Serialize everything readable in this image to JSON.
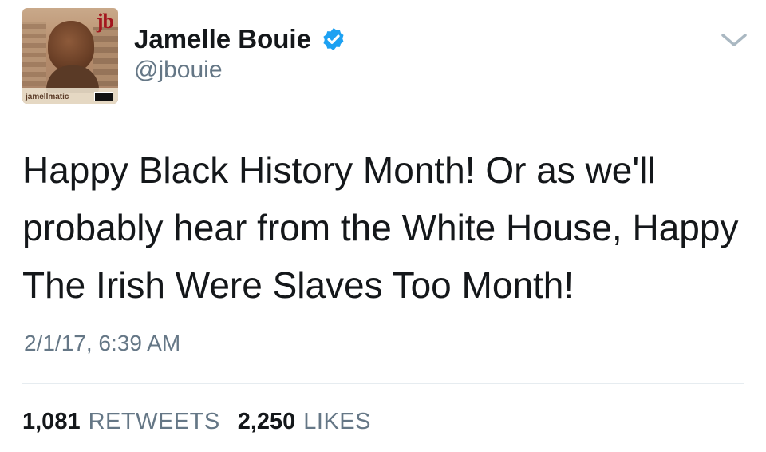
{
  "author": {
    "name": "Jamelle Bouie",
    "handle": "@jbouie",
    "avatar_logo_text": "jb",
    "avatar_tag_text": "jamellmatic"
  },
  "tweet": {
    "text": "Happy Black History Month! Or as we'll\nprobably hear from the White House, Happy\nThe Irish Were Slaves Too Month!",
    "timestamp": "2/1/17, 6:39 AM"
  },
  "stats": {
    "retweets_count": "1,081",
    "retweets_label": "RETWEETS",
    "likes_count": "2,250",
    "likes_label": "LIKES"
  },
  "icons": {
    "verified": "verified-badge-icon",
    "menu": "chevron-down-icon"
  },
  "colors": {
    "text_primary": "#14171a",
    "text_secondary": "#657786",
    "verified_blue": "#1da1f2",
    "divider": "#e6ecf0"
  }
}
